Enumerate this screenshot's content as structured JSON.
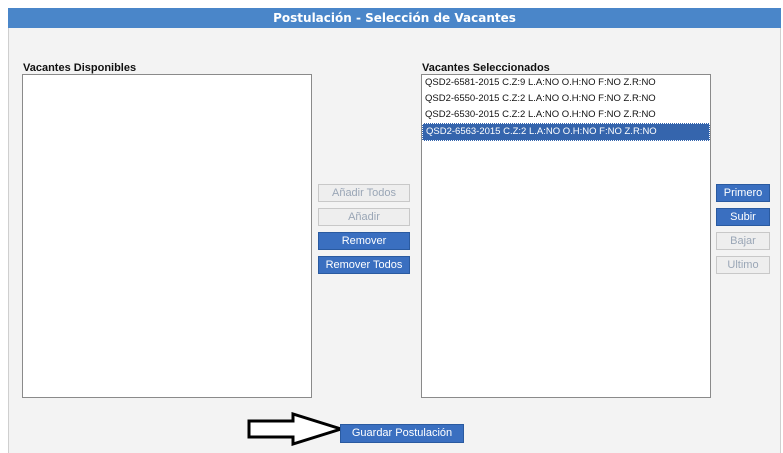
{
  "header": {
    "title": "Postulación - Selección de Vacantes"
  },
  "available": {
    "label": "Vacantes Disponibles",
    "items": []
  },
  "selected": {
    "label": "Vacantes Seleccionados",
    "items": [
      "QSD2-6581-2015 C.Z:9 L.A:NO O.H:NO F:NO Z.R:NO",
      "QSD2-6550-2015 C.Z:2 L.A:NO O.H:NO F:NO Z.R:NO",
      "QSD2-6530-2015 C.Z:2 L.A:NO O.H:NO F:NO Z.R:NO",
      "QSD2-6563-2015 C.Z:2 L.A:NO O.H:NO F:NO Z.R:NO"
    ],
    "selected_index": 3
  },
  "transfer_buttons": {
    "add_all": "Añadir Todos",
    "add": "Añadir",
    "remove": "Remover",
    "remove_all": "Remover Todos"
  },
  "order_buttons": {
    "first": "Primero",
    "up": "Subir",
    "down": "Bajar",
    "last": "Ultimo"
  },
  "footer": {
    "save_label": "Guardar Postulación"
  },
  "colors": {
    "accent": "#3a6fc0",
    "header": "#4a86c9",
    "selection": "#3565ad"
  }
}
